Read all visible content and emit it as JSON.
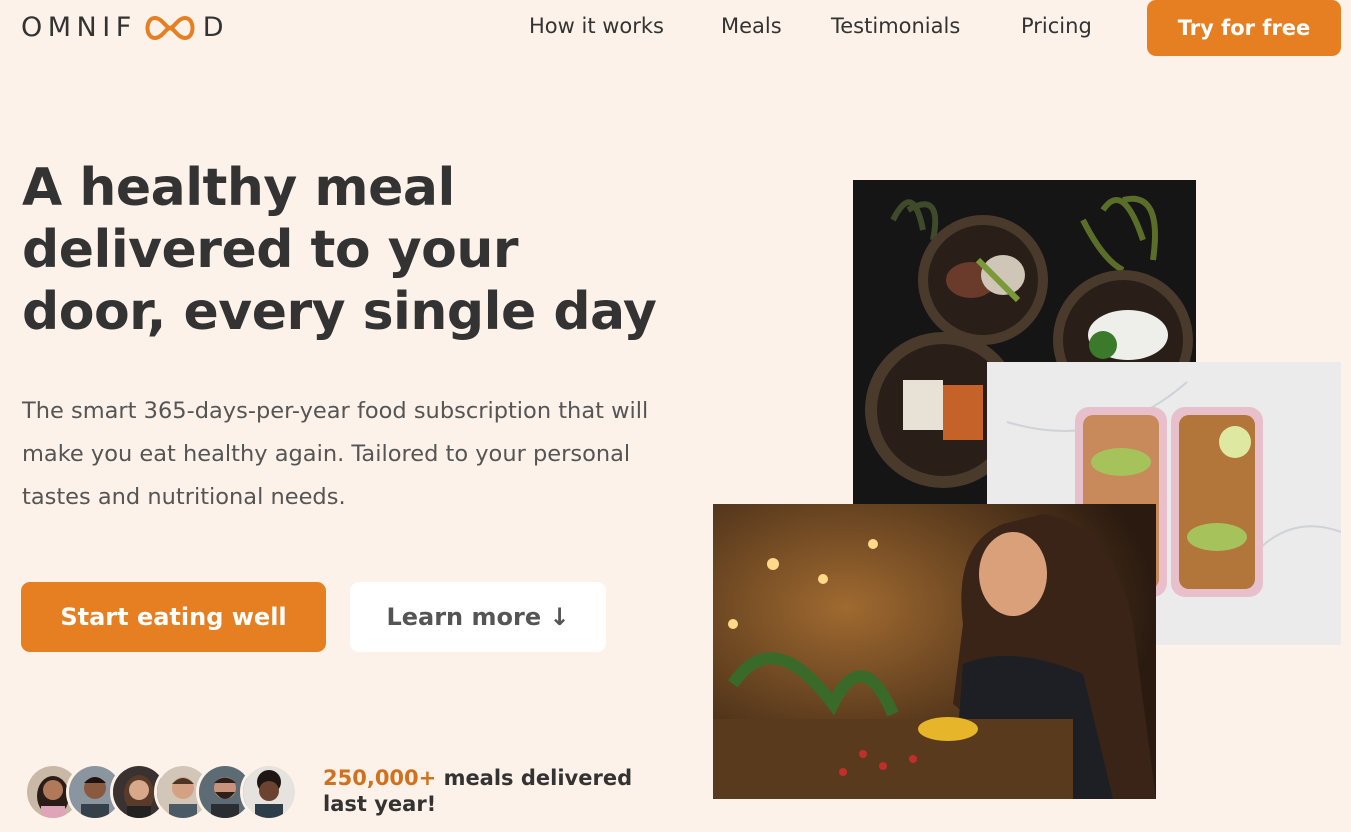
{
  "header": {
    "logo": {
      "prefix": "OMNIF",
      "suffix": "D",
      "icon": "infinity-loop-icon"
    },
    "nav": [
      "How it works",
      "Meals",
      "Testimonials",
      "Pricing"
    ],
    "cta_label": "Try for free"
  },
  "hero": {
    "title_lines": [
      "A healthy meal",
      "delivered to your",
      "door, every single day"
    ],
    "description": "The smart 365-days-per-year food subscription that will make you eat healthy again. Tailored to your personal tastes and nutritional needs.",
    "primary_button": "Start eating well",
    "secondary_button": "Learn more ↓",
    "delivered_count": "250,000+",
    "delivered_text": "meals delivered last year!"
  },
  "colors": {
    "accent": "#e67e22",
    "background": "#fdf2e9",
    "text": "#333333"
  }
}
